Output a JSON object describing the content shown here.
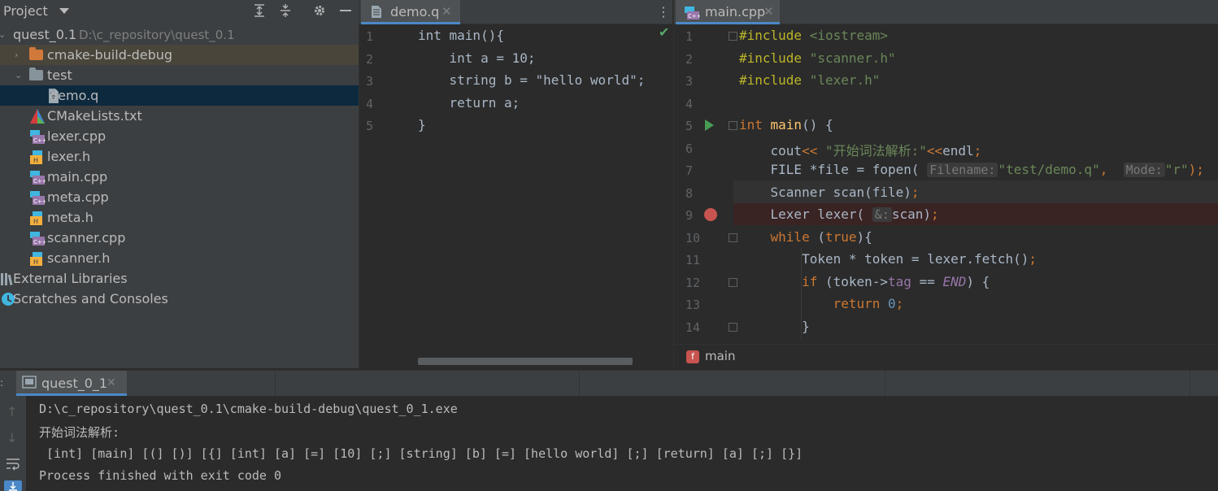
{
  "project": {
    "title": "Project",
    "tree": [
      {
        "label": "quest_0.1",
        "path": "D:\\c_repository\\quest_0.1",
        "type": "project"
      },
      {
        "label": "cmake-build-debug",
        "type": "folder-orange"
      },
      {
        "label": "test",
        "type": "folder"
      },
      {
        "label": "demo.q",
        "type": "file"
      },
      {
        "label": "CMakeLists.txt",
        "type": "cmake"
      },
      {
        "label": "lexer.cpp",
        "type": "cpp"
      },
      {
        "label": "lexer.h",
        "type": "h"
      },
      {
        "label": "main.cpp",
        "type": "cpp"
      },
      {
        "label": "meta.cpp",
        "type": "cpp"
      },
      {
        "label": "meta.h",
        "type": "h"
      },
      {
        "label": "scanner.cpp",
        "type": "cpp"
      },
      {
        "label": "scanner.h",
        "type": "h"
      },
      {
        "label": "External Libraries",
        "type": "libs"
      },
      {
        "label": "Scratches and Consoles",
        "type": "scratches"
      }
    ]
  },
  "editor_left": {
    "tab": "demo.q",
    "line_numbers": [
      "1",
      "2",
      "3",
      "4",
      "5"
    ],
    "lines": [
      {
        "tokens": [
          {
            "t": "int main(){",
            "c": ""
          }
        ]
      },
      {
        "tokens": [
          {
            "t": "    int a = 10;",
            "c": ""
          }
        ]
      },
      {
        "tokens": [
          {
            "t": "    string b = \"hello world\";",
            "c": ""
          }
        ]
      },
      {
        "tokens": [
          {
            "t": "    return a;",
            "c": ""
          }
        ]
      },
      {
        "tokens": [
          {
            "t": "}",
            "c": ""
          }
        ]
      }
    ]
  },
  "editor_right": {
    "tab": "main.cpp",
    "line_numbers": [
      "1",
      "2",
      "3",
      "4",
      "5",
      "6",
      "7",
      "8",
      "9",
      "10",
      "11",
      "12",
      "13",
      "14"
    ],
    "lines": [
      {
        "tokens": [
          {
            "t": "#include ",
            "c": "macro"
          },
          {
            "t": "<iostream>",
            "c": "str"
          }
        ]
      },
      {
        "tokens": [
          {
            "t": "#include ",
            "c": "macro"
          },
          {
            "t": "\"scanner.h\"",
            "c": "str"
          }
        ]
      },
      {
        "tokens": [
          {
            "t": "#include ",
            "c": "macro"
          },
          {
            "t": "\"lexer.h\"",
            "c": "str"
          }
        ]
      },
      {
        "tokens": []
      },
      {
        "tokens": [
          {
            "t": "int ",
            "c": "kw"
          },
          {
            "t": "main",
            "c": "fn"
          },
          {
            "t": "() {",
            "c": ""
          }
        ]
      },
      {
        "tokens": [
          {
            "t": "    cout",
            "c": ""
          },
          {
            "t": "<< ",
            "c": "kw"
          },
          {
            "t": "\"开始词法解析:\"",
            "c": "str"
          },
          {
            "t": "<<",
            "c": "kw"
          },
          {
            "t": "endl",
            "c": ""
          },
          {
            "t": ";",
            "c": "kw"
          }
        ]
      },
      {
        "tokens": [
          {
            "t": "    FILE *file = fopen( ",
            "c": ""
          },
          {
            "t": "Filename:",
            "c": "hint"
          },
          {
            "t": "\"test/demo.q\"",
            "c": "str"
          },
          {
            "t": ",  ",
            "c": "kw"
          },
          {
            "t": "Mode:",
            "c": "hint"
          },
          {
            "t": "\"r\"",
            "c": "str"
          },
          {
            "t": ");",
            "c": "kw"
          }
        ]
      },
      {
        "tokens": [
          {
            "t": "    Scanner scan(file)",
            "c": ""
          },
          {
            "t": ";",
            "c": "kw"
          }
        ]
      },
      {
        "tokens": [
          {
            "t": "    Lexer lexer( ",
            "c": ""
          },
          {
            "t": "&:",
            "c": "hint"
          },
          {
            "t": "scan)",
            "c": ""
          },
          {
            "t": ";",
            "c": "kw"
          }
        ]
      },
      {
        "tokens": [
          {
            "t": "    while ",
            "c": "kw"
          },
          {
            "t": "(",
            "c": ""
          },
          {
            "t": "true",
            "c": "kw"
          },
          {
            "t": "){",
            "c": ""
          }
        ]
      },
      {
        "tokens": [
          {
            "t": "        Token * token = lexer.fetch()",
            "c": ""
          },
          {
            "t": ";",
            "c": "kw"
          }
        ]
      },
      {
        "tokens": [
          {
            "t": "        if ",
            "c": "kw"
          },
          {
            "t": "(token->",
            "c": ""
          },
          {
            "t": "tag",
            "c": "field"
          },
          {
            "t": " == ",
            "c": ""
          },
          {
            "t": "END",
            "c": "const"
          },
          {
            "t": ") {",
            "c": ""
          }
        ]
      },
      {
        "tokens": [
          {
            "t": "            return ",
            "c": "kw"
          },
          {
            "t": "0",
            "c": "num"
          },
          {
            "t": ";",
            "c": "kw"
          }
        ]
      },
      {
        "tokens": [
          {
            "t": "        }",
            "c": ""
          }
        ]
      }
    ],
    "breadcrumb": "main",
    "breadcrumb_badge": "f"
  },
  "run": {
    "tab": "quest_0_1",
    "output": [
      "D:\\c_repository\\quest_0.1\\cmake-build-debug\\quest_0_1.exe",
      "开始词法解析:",
      " [int] [main] [(] [)] [{] [int] [a] [=] [10] [;] [string] [b] [=] [hello world] [;] [return] [a] [;] [}]",
      "Process finished with exit code 0"
    ]
  }
}
